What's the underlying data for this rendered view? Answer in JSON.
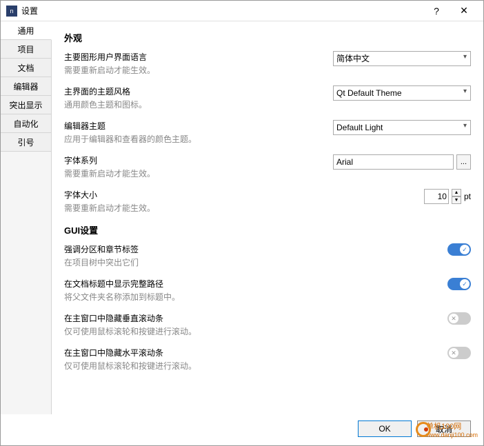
{
  "window": {
    "title": "设置"
  },
  "sidebar": {
    "tabs": [
      {
        "label": "通用"
      },
      {
        "label": "项目"
      },
      {
        "label": "文档"
      },
      {
        "label": "编辑器"
      },
      {
        "label": "突出显示"
      },
      {
        "label": "自动化"
      },
      {
        "label": "引号"
      }
    ]
  },
  "content": {
    "section1": "外观",
    "lang": {
      "label": "主要图形用户界面语言",
      "hint": "需要重新启动才能生效。",
      "value": "简体中文"
    },
    "theme": {
      "label": "主界面的主题风格",
      "hint": "通用颜色主题和图标。",
      "value": "Qt Default Theme"
    },
    "editorTheme": {
      "label": "编辑器主题",
      "hint": "应用于编辑器和查看器的颜色主题。",
      "value": "Default Light"
    },
    "font": {
      "label": "字体系列",
      "hint": "需要重新启动才能生效。",
      "value": "Arial"
    },
    "fontSize": {
      "label": "字体大小",
      "hint": "需要重新启动才能生效。",
      "value": "10",
      "unit": "pt"
    },
    "section2": "GUI设置",
    "opt1": {
      "label": "强调分区和章节标签",
      "hint": "在项目树中突出它们"
    },
    "opt2": {
      "label": "在文档标题中显示完整路径",
      "hint": "将父文件夹名称添加到标题中。"
    },
    "opt3": {
      "label": "在主窗口中隐藏垂直滚动条",
      "hint": "仅可使用鼠标滚轮和按键进行滚动。"
    },
    "opt4": {
      "label": "在主窗口中隐藏水平滚动条",
      "hint": "仅可使用鼠标滚轮和按键进行滚动。"
    }
  },
  "footer": {
    "ok": "OK",
    "cancel": "取消"
  },
  "watermark": {
    "line1": "单机100网",
    "line2": "www.danji100.com"
  }
}
